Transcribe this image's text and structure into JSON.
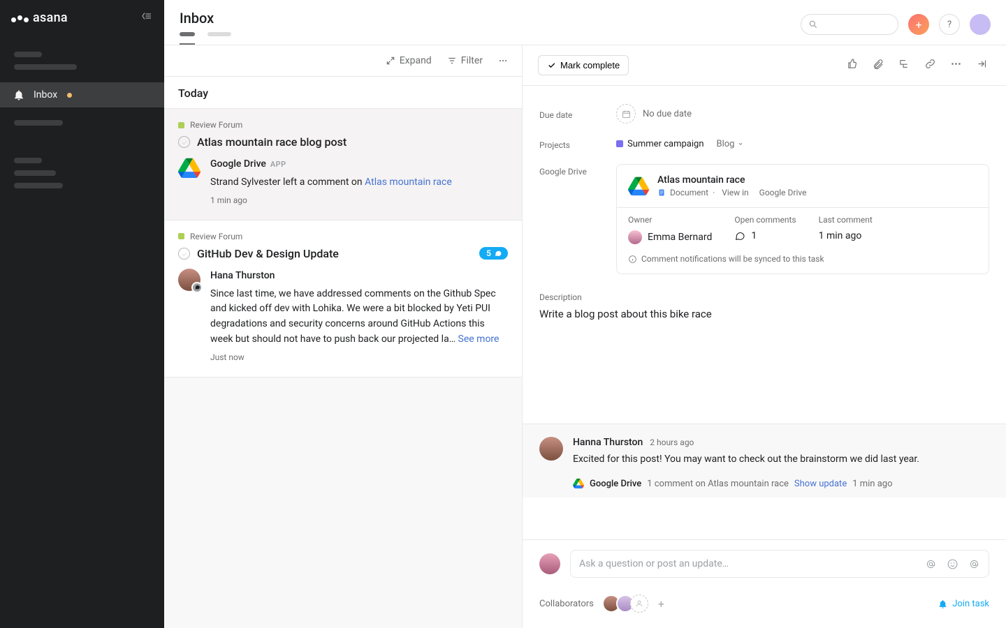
{
  "brand": "asana",
  "page_title": "Inbox",
  "sidebar": {
    "inbox_label": "Inbox"
  },
  "toolbar": {
    "expand": "Expand",
    "filter": "Filter"
  },
  "inbox": {
    "section": "Today",
    "items": [
      {
        "project": "Review Forum",
        "title": "Atlas mountain race blog post",
        "actor": "Google Drive",
        "app_label": "APP",
        "summary_prefix": "Strand Sylvester left a comment on ",
        "summary_link": "Atlas mountain race",
        "time": "1 min ago"
      },
      {
        "project": "Review Forum",
        "title": "GitHub Dev & Design Update",
        "badge_count": "5",
        "actor": "Hana Thurston",
        "summary": "Since last time, we have addressed comments on the Github Spec and kicked off dev with Lohika. We were a bit blocked by Yeti PUI degradations and security concerns around GitHub Actions this week but should not have to push back our projected la… ",
        "see_more": "See more",
        "time": "Just now"
      }
    ]
  },
  "detail": {
    "mark_complete": "Mark complete",
    "fields": {
      "due_date_label": "Due date",
      "due_date_value": "No due date",
      "projects_label": "Projects",
      "project_name": "Summer campaign",
      "project_section": "Blog",
      "gdrive_label": "Google Drive",
      "description_label": "Description",
      "description_text": "Write a blog post about this bike race"
    },
    "gdrive_card": {
      "title": "Atlas mountain race",
      "doc_type": "Document",
      "view_in": "View in",
      "service": "Google Drive",
      "owner_label": "Owner",
      "owner": "Emma Bernard",
      "open_label": "Open comments",
      "open_count": "1",
      "last_label": "Last comment",
      "last_value": "1 min ago",
      "note": "Comment notifications will be synced to this task"
    },
    "comment": {
      "author": "Hanna Thurston",
      "time": "2 hours ago",
      "text": "Excited for this post! You may want to check out the brainstorm we did last year."
    },
    "update": {
      "service": "Google Drive",
      "text": "1 comment on Atlas mountain race",
      "show": "Show update",
      "time": "1 min ago"
    },
    "composer_placeholder": "Ask a question or post an update…",
    "collaborators_label": "Collaborators",
    "join_task": "Join task"
  }
}
